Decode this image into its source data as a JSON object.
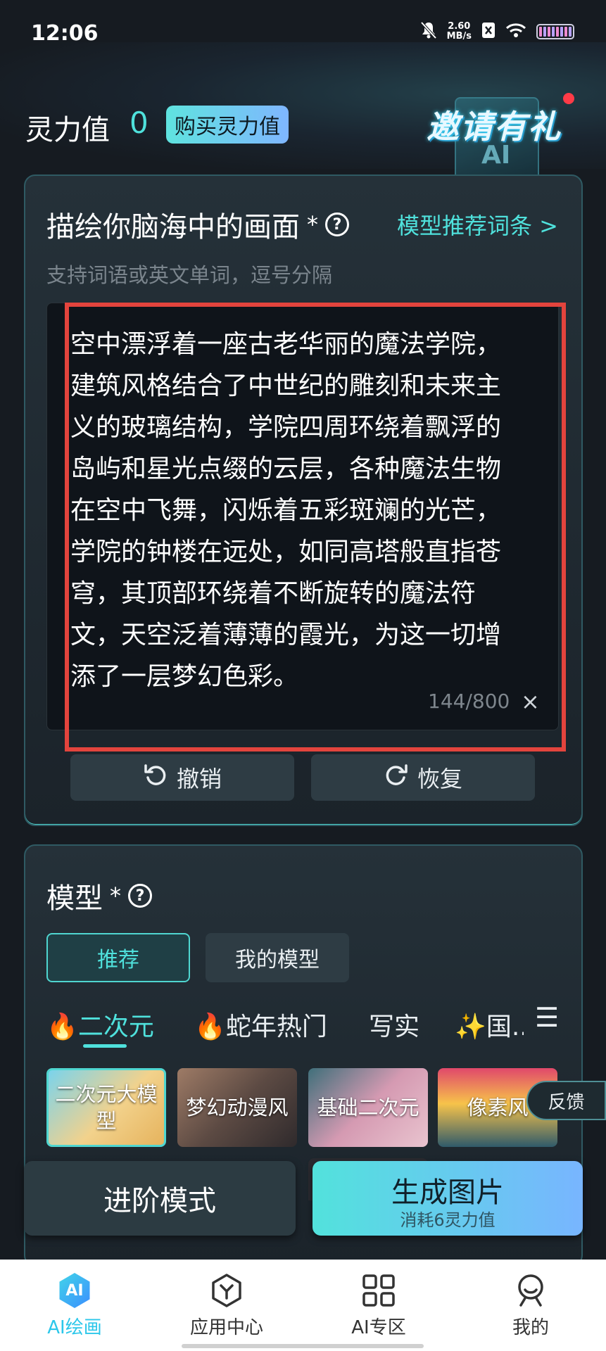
{
  "status_bar": {
    "time": "12:06",
    "net_speed_value": "2.60",
    "net_speed_unit": "MB/s"
  },
  "header": {
    "power_label": "灵力值",
    "power_value": "0",
    "buy_label": "购买灵力值",
    "invite_label": "邀请有礼",
    "invite_ai": "AI"
  },
  "prompt_card": {
    "title": "描绘你脑海中的画面",
    "required_mark": "*",
    "help_icon": "?",
    "recommend_link": "模型推荐词条 >",
    "hint": "支持词语或英文单词，逗号分隔",
    "prompt_text": "空中漂浮着一座古老华丽的魔法学院，\n建筑风格结合了中世纪的雕刻和未来主\n义的玻璃结构，学院四周环绕着飘浮的\n岛屿和星光点缀的云层，各种魔法生物\n在空中飞舞，闪烁着五彩斑斓的光芒，\n学院的钟楼在远处，如同高塔般直指苍\n穹，其顶部环绕着不断旋转的魔法符\n文，天空泛着薄薄的霞光，为这一切增\n添了一层梦幻色彩。",
    "char_count": "144/800",
    "clear_icon": "×",
    "undo_label": "撤销",
    "redo_label": "恢复"
  },
  "model_card": {
    "title": "模型",
    "required_mark": "*",
    "help_icon": "?",
    "segments": [
      "推荐",
      "我的模型"
    ],
    "categories": [
      "🔥二次元",
      "🔥蛇年热门",
      "写实",
      "✨国..."
    ],
    "menu_icon": "☰",
    "models": [
      "二次元大模型",
      "梦幻动漫风",
      "基础二次元",
      "像素风"
    ],
    "feedback_label": "反馈"
  },
  "actions": {
    "advanced_label": "进阶模式",
    "generate_label": "生成图片",
    "generate_cost": "消耗6灵力值"
  },
  "bottom_nav": {
    "items": [
      {
        "label": "AI绘画",
        "icon": "ai-hexagon-icon",
        "icon_text": "AI"
      },
      {
        "label": "应用中心",
        "icon": "app-center-icon"
      },
      {
        "label": "AI专区",
        "icon": "grid-icon"
      },
      {
        "label": "我的",
        "icon": "profile-icon"
      }
    ]
  },
  "colors": {
    "accent": "#4fe1dc",
    "highlight": "#e3443d",
    "background": "#161b21"
  }
}
